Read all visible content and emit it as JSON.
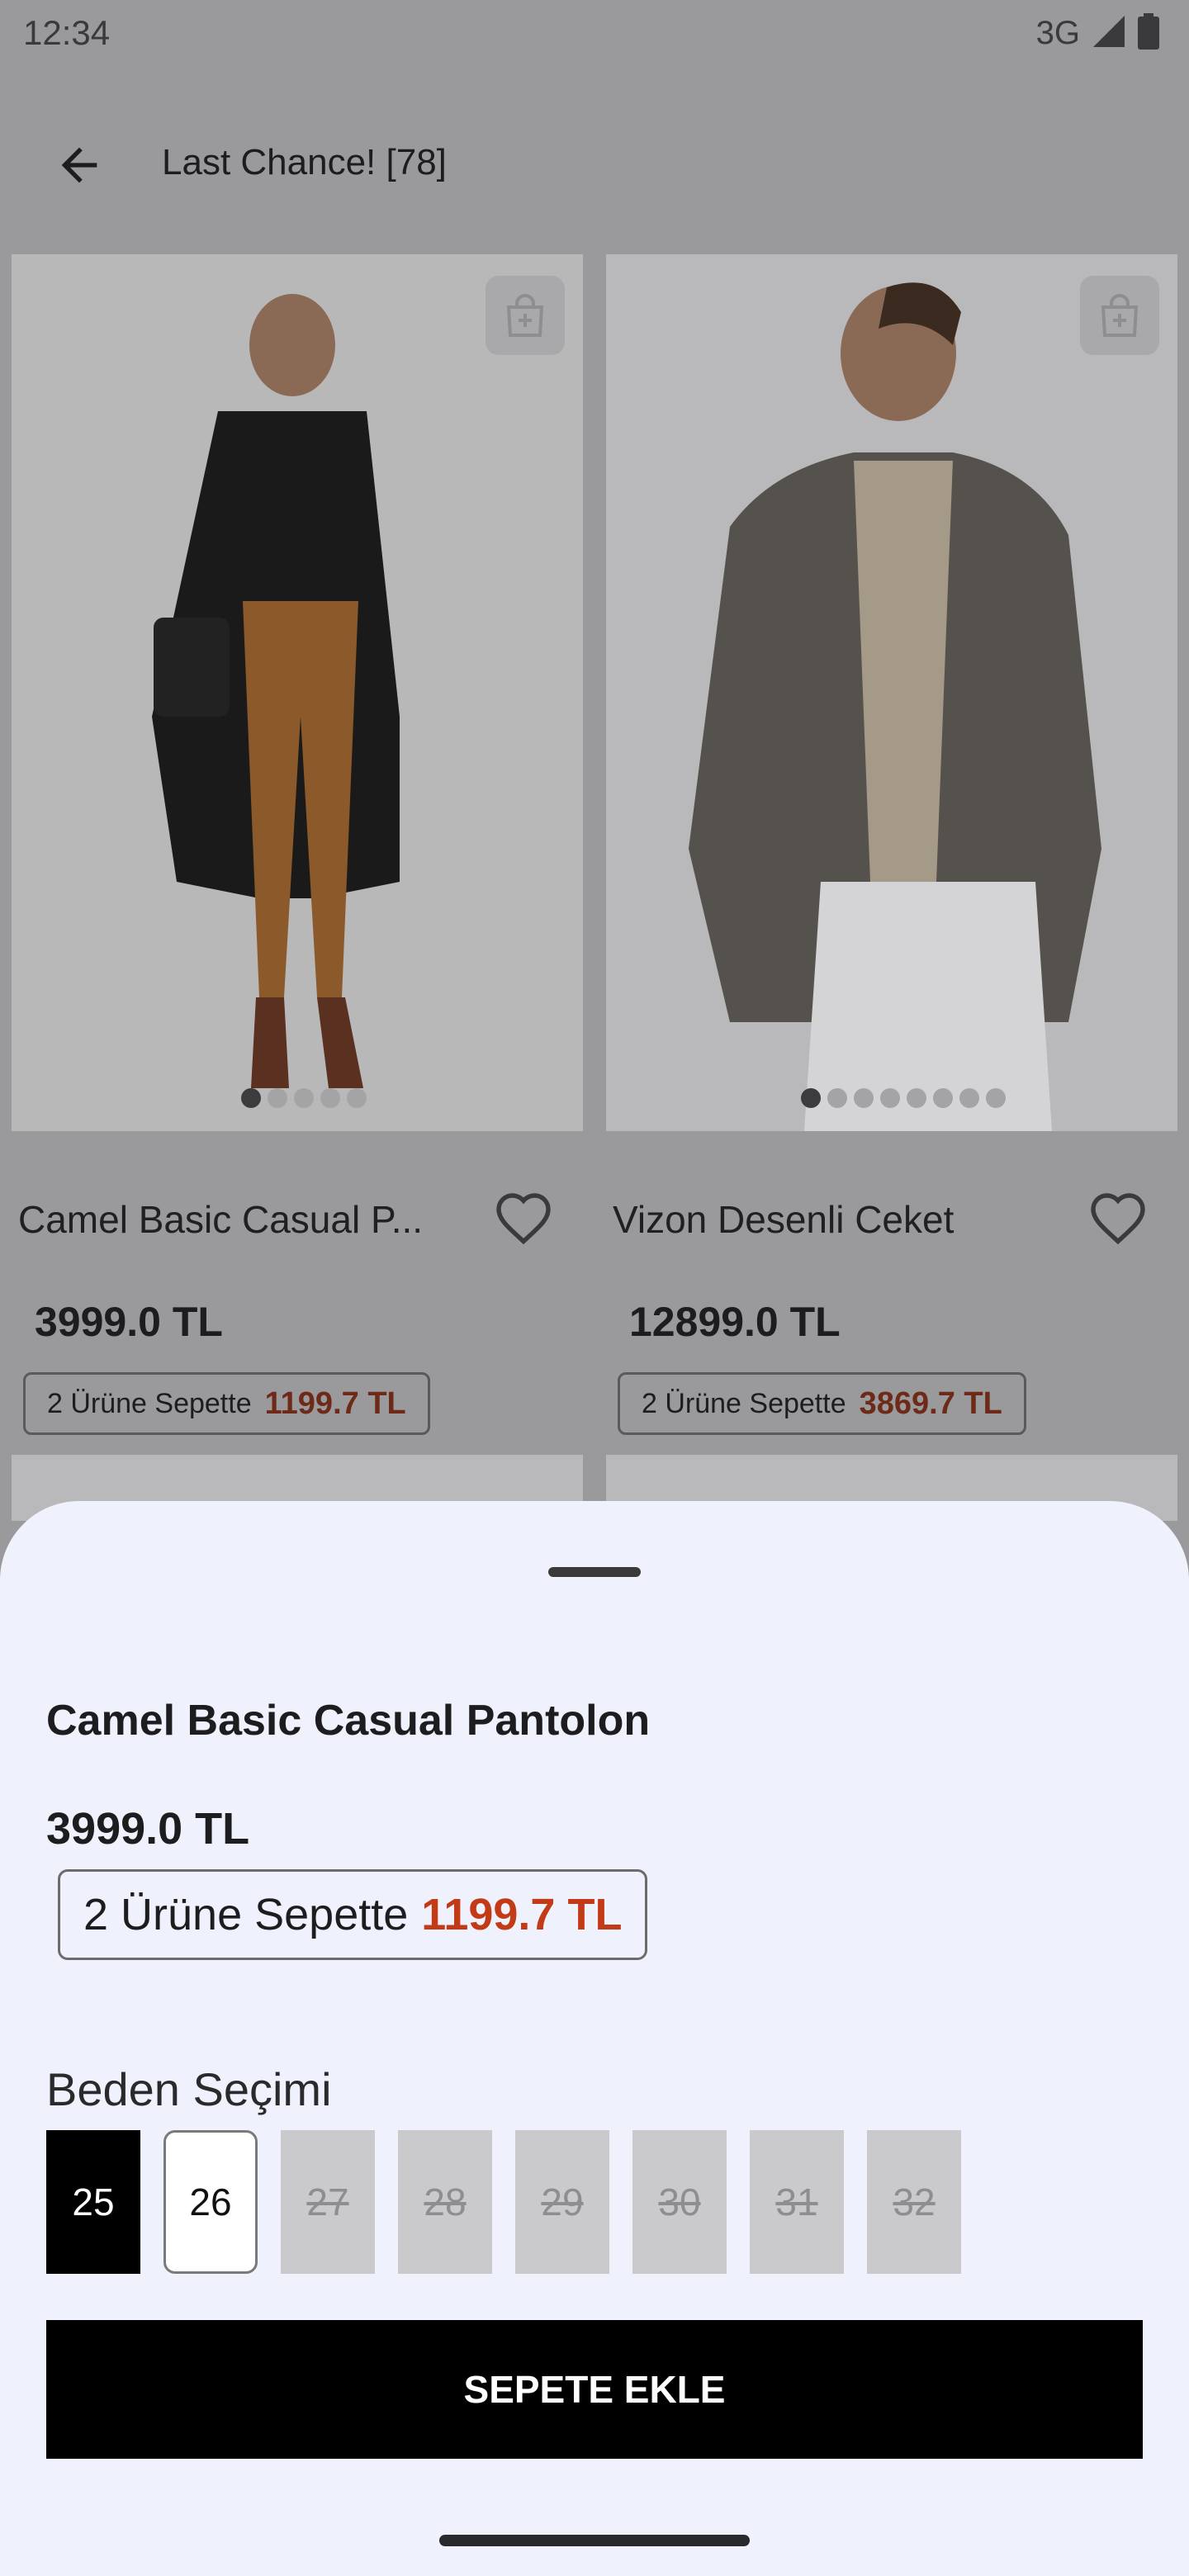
{
  "status_bar": {
    "time": "12:34",
    "network": "3G"
  },
  "header": {
    "title": "Last Chance! [78]"
  },
  "products": [
    {
      "name": "Camel Basic Casual P...",
      "price": "3999.0 TL",
      "promo_label": "2 Ürüne Sepette",
      "promo_price": "1199.7 TL",
      "image_dots": 5,
      "active_dot": 0
    },
    {
      "name": "Vizon Desenli Ceket",
      "price": "12899.0 TL",
      "promo_label": "2 Ürüne Sepette",
      "promo_price": "3869.7 TL",
      "image_dots": 8,
      "active_dot": 0
    }
  ],
  "sheet": {
    "title": "Camel Basic Casual Pantolon",
    "price": "3999.0 TL",
    "promo_label": "2 Ürüne Sepette",
    "promo_price": "1199.7 TL",
    "size_label": "Beden Seçimi",
    "sizes": [
      {
        "label": "25",
        "state": "selected"
      },
      {
        "label": "26",
        "state": "available"
      },
      {
        "label": "27",
        "state": "disabled"
      },
      {
        "label": "28",
        "state": "disabled"
      },
      {
        "label": "29",
        "state": "disabled"
      },
      {
        "label": "30",
        "state": "disabled"
      },
      {
        "label": "31",
        "state": "disabled"
      },
      {
        "label": "32",
        "state": "disabled"
      }
    ],
    "add_to_cart_label": "SEPETE EKLE"
  },
  "colors": {
    "promo_red": "#c23b16",
    "scrim": "#9a9a9c",
    "sheet_bg": "#eff1fc"
  }
}
